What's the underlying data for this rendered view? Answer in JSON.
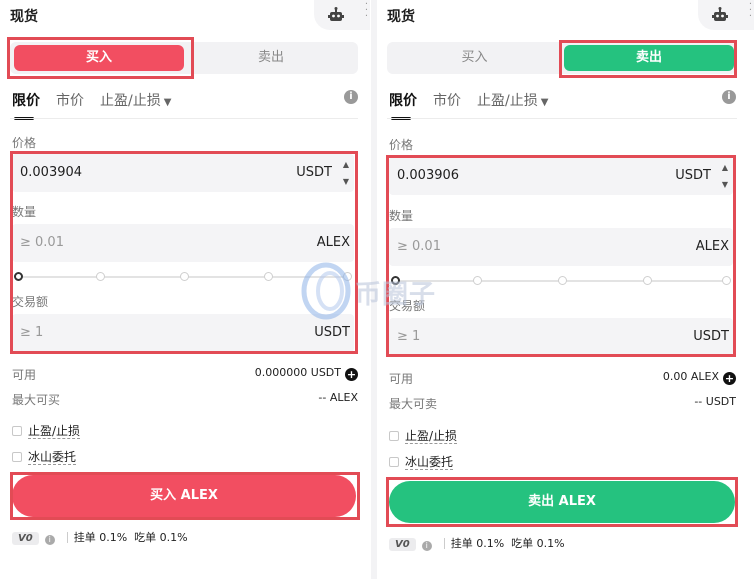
{
  "buy_panel": {
    "title": "现货",
    "side_buy": "买入",
    "side_sell": "卖出",
    "tabs": {
      "limit": "限价",
      "market": "市价",
      "tpsl": "止盈/止损"
    },
    "price_label": "价格",
    "price_value": "0.003904",
    "price_unit": "USDT",
    "amount_label": "数量",
    "amount_placeholder": "≥ 0.01",
    "amount_unit": "ALEX",
    "total_label": "交易额",
    "total_placeholder": "≥ 1",
    "total_unit": "USDT",
    "available_label": "可用",
    "available_value": "0.000000 USDT",
    "max_label": "最大可买",
    "max_value": "-- ALEX",
    "opt_tpsl": "止盈/止损",
    "opt_iceberg": "冰山委托",
    "submit": "买入 ALEX",
    "vip": "V0",
    "maker": "挂单 0.1%",
    "taker": "吃单 0.1%"
  },
  "sell_panel": {
    "title": "现货",
    "side_buy": "买入",
    "side_sell": "卖出",
    "tabs": {
      "limit": "限价",
      "market": "市价",
      "tpsl": "止盈/止损"
    },
    "price_label": "价格",
    "price_value": "0.003906",
    "price_unit": "USDT",
    "amount_label": "数量",
    "amount_placeholder": "≥ 0.01",
    "amount_unit": "ALEX",
    "total_label": "交易额",
    "total_placeholder": "≥ 1",
    "total_unit": "USDT",
    "available_label": "可用",
    "available_value": "0.00 ALEX",
    "max_label": "最大可卖",
    "max_value": "-- USDT",
    "opt_tpsl": "止盈/止损",
    "opt_iceberg": "冰山委托",
    "submit": "卖出 ALEX",
    "vip": "V0",
    "maker": "挂单 0.1%",
    "taker": "吃单 0.1%"
  },
  "watermark": "币圈子",
  "colors": {
    "buy": "#f24e61",
    "sell": "#25c27f",
    "highlight": "#e24b55"
  },
  "icons": [
    "robot-icon",
    "info-icon",
    "plus-circle-icon",
    "caret-down-icon"
  ]
}
